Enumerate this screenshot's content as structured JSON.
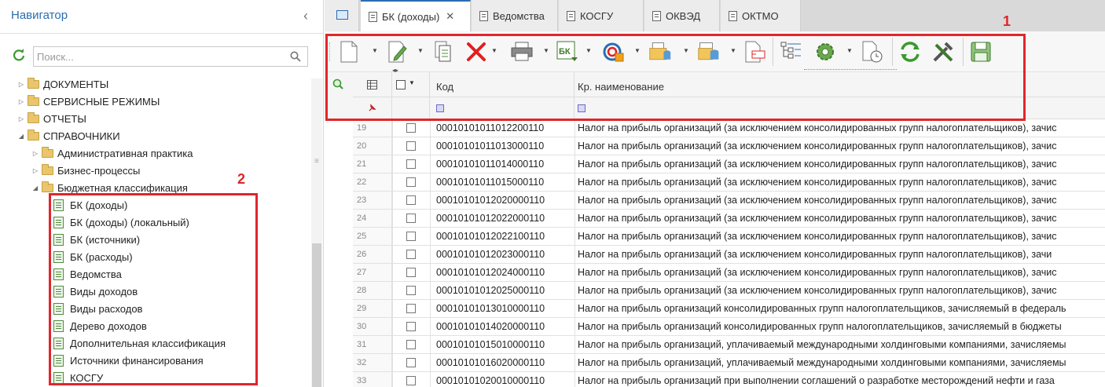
{
  "navigator": {
    "title": "Навигатор",
    "collapse_glyph": "‹",
    "search_placeholder": "Поиск...",
    "tree": [
      {
        "label": "ДОКУМЕНТЫ",
        "level": 0,
        "expanded": false
      },
      {
        "label": "СЕРВИСНЫЕ РЕЖИМЫ",
        "level": 0,
        "expanded": false
      },
      {
        "label": "ОТЧЕТЫ",
        "level": 0,
        "expanded": false
      },
      {
        "label": "СПРАВОЧНИКИ",
        "level": 0,
        "expanded": true
      },
      {
        "label": "Административная практика",
        "level": 1,
        "expanded": false
      },
      {
        "label": "Бизнес-процессы",
        "level": 1,
        "expanded": false
      },
      {
        "label": "Бюджетная классификация",
        "level": 1,
        "expanded": true
      }
    ],
    "items": [
      "БК (доходы)",
      "БК (доходы) (локальный)",
      "БК (источники)",
      "БК (расходы)",
      "Ведомства",
      "Виды доходов",
      "Виды расходов",
      "Дерево доходов",
      "Дополнительная классификация",
      "Источники финансирования",
      "КОСГУ"
    ]
  },
  "tabs": [
    {
      "label": "БК (доходы)",
      "active": true,
      "close": "✕"
    },
    {
      "label": "Ведомства",
      "active": false
    },
    {
      "label": "КОСГУ",
      "active": false
    },
    {
      "label": "ОКВЭД",
      "active": false
    },
    {
      "label": "ОКТМО",
      "active": false
    }
  ],
  "toolbar": {
    "buttons": [
      "new-doc",
      "edit",
      "copy",
      "delete",
      "print",
      "bk-export",
      "sync",
      "import",
      "export-db",
      "attach",
      "structure",
      "settings",
      "history",
      "refresh",
      "tools",
      "save"
    ],
    "resize_glyph": "◂▸"
  },
  "grid": {
    "columns": {
      "code": "Код",
      "name": "Кр. наименование"
    },
    "rows": [
      {
        "n": "19",
        "code": "00010101011012200110",
        "name": "Налог на прибыль организаций (за исключением консолидированных групп налогоплательщиков), зачис"
      },
      {
        "n": "20",
        "code": "00010101011013000110",
        "name": "Налог на прибыль организаций (за исключением консолидированных групп налогоплательщиков), зачис"
      },
      {
        "n": "21",
        "code": "00010101011014000110",
        "name": "Налог на прибыль организаций (за исключением консолидированных групп налогоплательщиков), зачис"
      },
      {
        "n": "22",
        "code": "00010101011015000110",
        "name": "Налог на прибыль организаций (за исключением консолидированных групп налогоплательщиков), зачис"
      },
      {
        "n": "23",
        "code": "00010101012020000110",
        "name": "Налог на прибыль организаций (за исключением консолидированных групп налогоплательщиков), зачис"
      },
      {
        "n": "24",
        "code": "00010101012022000110",
        "name": "Налог на прибыль организаций (за исключением консолидированных групп налогоплательщиков), зачис"
      },
      {
        "n": "25",
        "code": "00010101012022100110",
        "name": "Налог на прибыль организаций (за исключением консолидированных групп налогоплательщиков), зачис"
      },
      {
        "n": "26",
        "code": "00010101012023000110",
        "name": "Налог на прибыль организаций (за исключением консолидированных групп налогоплательщиков), зачи"
      },
      {
        "n": "27",
        "code": "00010101012024000110",
        "name": "Налог на прибыль организаций (за исключением консолидированных групп налогоплательщиков), зачис"
      },
      {
        "n": "28",
        "code": "00010101012025000110",
        "name": "Налог на прибыль организаций (за исключением консолидированных групп налогоплательщиков), зачис"
      },
      {
        "n": "29",
        "code": "00010101013010000110",
        "name": "Налог на прибыль организаций консолидированных групп налогоплательщиков, зачисляемый в федераль"
      },
      {
        "n": "30",
        "code": "00010101014020000110",
        "name": "Налог на прибыль организаций консолидированных групп налогоплательщиков, зачисляемый в бюджеты"
      },
      {
        "n": "31",
        "code": "00010101015010000110",
        "name": "Налог на прибыль организаций, уплачиваемый международными холдинговыми компаниями, зачисляемы"
      },
      {
        "n": "32",
        "code": "00010101016020000110",
        "name": "Налог на прибыль организаций, уплачиваемый международными холдинговыми компаниями, зачисляемы"
      },
      {
        "n": "33",
        "code": "00010101020010000110",
        "name": "Налог на прибыль организаций при выполнении соглашений о разработке месторождений нефти и газа"
      }
    ]
  },
  "annotations": {
    "one": "1",
    "two": "2"
  },
  "colors": {
    "accent": "#2b6cb0",
    "highlight": "#e0262b",
    "folder": "#e9c56b",
    "doc": "#4f8a3c"
  }
}
